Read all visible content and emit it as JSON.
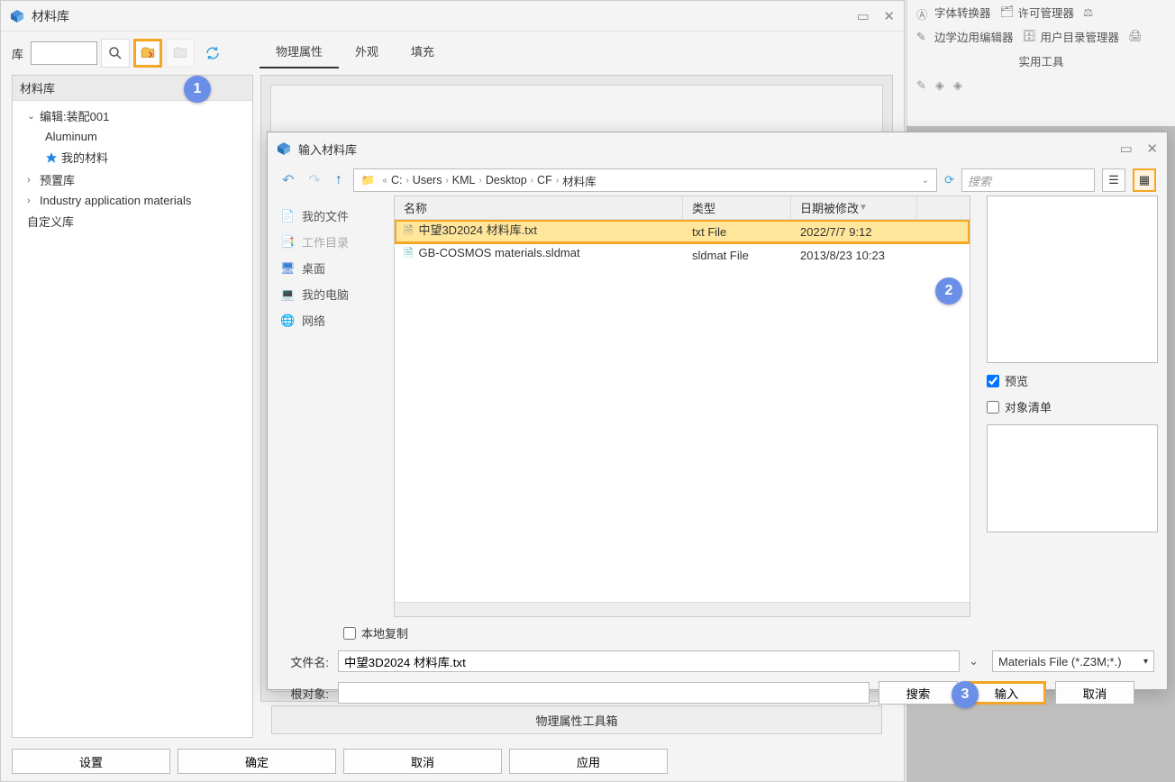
{
  "main": {
    "title": "材料库",
    "lib_label": "库",
    "lib_value": "",
    "tabs": [
      "物理属性",
      "外观",
      "填充"
    ],
    "panel_header": "材料库",
    "tree": [
      {
        "expander": "⌄",
        "label": "编辑:装配001",
        "indent": 0
      },
      {
        "expander": "",
        "label": "Aluminum",
        "indent": 1
      },
      {
        "expander": "",
        "label": "我的材料",
        "indent": 1,
        "star": true
      },
      {
        "expander": "›",
        "label": "预置库",
        "indent": 0
      },
      {
        "expander": "›",
        "label": "Industry application materials",
        "indent": 0
      },
      {
        "expander": "",
        "label": "自定义库",
        "indent": 0
      }
    ],
    "toolbox_label": "物理属性工具箱",
    "buttons": [
      "设置",
      "确定",
      "取消",
      "应用"
    ]
  },
  "side": {
    "items": [
      {
        "icon": "A",
        "label": "字体转换器"
      },
      {
        "icon": "📋",
        "label": "许可管理器"
      },
      {
        "icon": "⚙",
        "label": ""
      },
      {
        "icon": "📐",
        "label": "边学边用编辑器"
      },
      {
        "icon": "📁",
        "label": "用户目录管理器"
      },
      {
        "icon": "🔧",
        "label": ""
      }
    ],
    "group_label": "实用工具"
  },
  "dialog": {
    "title": "输入材料库",
    "breadcrumb": [
      "C:",
      "Users",
      "KML",
      "Desktop",
      "CF",
      "材料库"
    ],
    "search_placeholder": "搜索",
    "places": [
      {
        "icon": "📄",
        "label": "我的文件"
      },
      {
        "icon": "📑",
        "label": "工作目录",
        "disabled": true
      },
      {
        "icon": "🖥",
        "label": "桌面"
      },
      {
        "icon": "💻",
        "label": "我的电脑"
      },
      {
        "icon": "🌐",
        "label": "网络"
      }
    ],
    "columns": {
      "name": "名称",
      "type": "类型",
      "date": "日期被修改"
    },
    "files": [
      {
        "name": "中望3D2024 材料库.txt",
        "type": "txt File",
        "date": "2022/7/7 9:12",
        "selected": true
      },
      {
        "name": "GB-COSMOS materials.sldmat",
        "type": "sldmat File",
        "date": "2013/8/23 10:23",
        "selected": false
      }
    ],
    "preview_label": "预览",
    "objlist_label": "对象清单",
    "local_copy_label": "本地复制",
    "filename_label": "文件名:",
    "filename_value": "中望3D2024 材料库.txt",
    "root_label": "根对象:",
    "root_value": "",
    "filetype_label": "Materials File (*.Z3M;*.)",
    "search_btn": "搜索",
    "open_btn": "输入",
    "cancel_btn": "取消"
  },
  "callouts": {
    "1": "1",
    "2": "2",
    "3": "3"
  }
}
